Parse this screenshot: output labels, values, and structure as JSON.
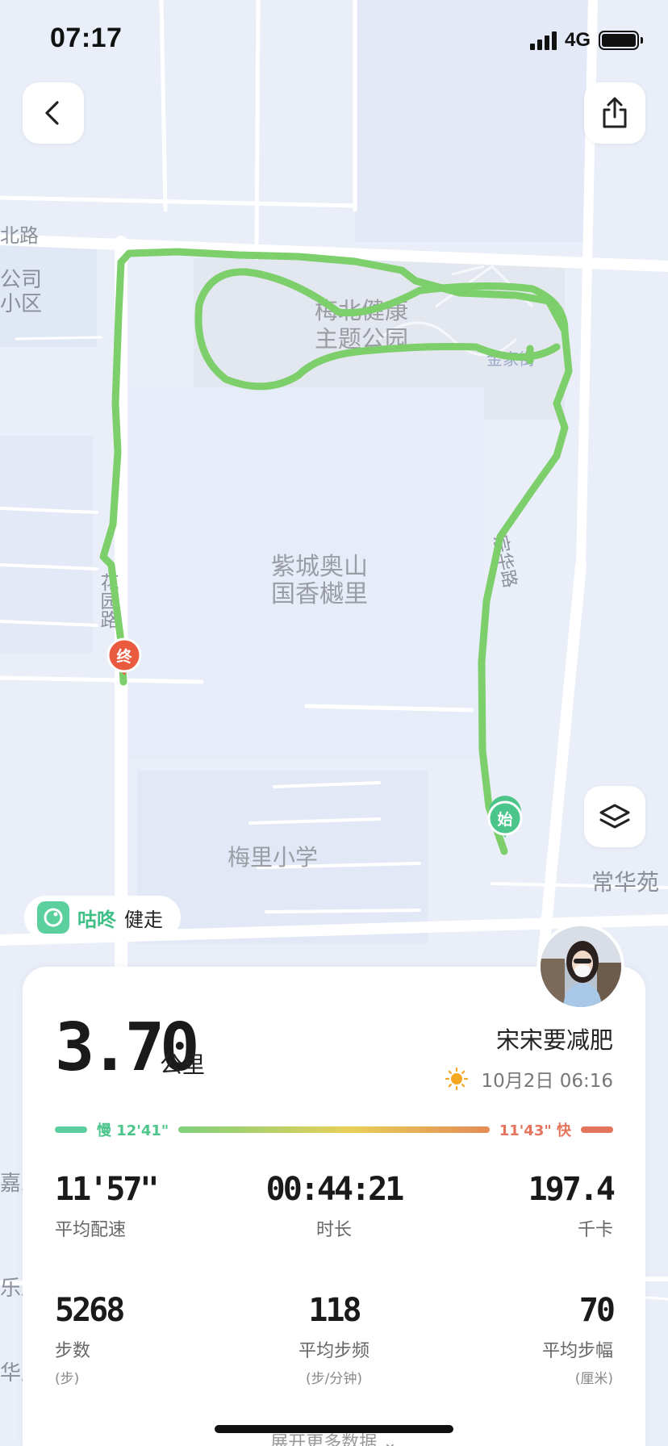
{
  "status_bar": {
    "time": "07:17",
    "network": "4G",
    "signal_icon": "signal-icon",
    "battery_icon": "battery-icon"
  },
  "map": {
    "labels": {
      "road_north": "北路",
      "company": "公司",
      "district": "小区",
      "park_line1": "梅北健康",
      "park_line2": "主题公园",
      "jinjia": "金家街",
      "residence_line1": "紫城奥山",
      "residence_line2": "国香樾里",
      "huayuan_road": "花园路",
      "zonghua_road": "宗华路",
      "school": "梅里小学",
      "changhua": "常华苑",
      "edge1": "嘉乐",
      "edge2": "乐路",
      "edge3": "华庭"
    },
    "start_marker": "始",
    "end_marker": "终",
    "route_color": "#7ccf6a",
    "start_color": "#4cc58a",
    "end_color": "#ea5a3f"
  },
  "buttons": {
    "back_icon": "chevron-left-icon",
    "share_icon": "share-icon",
    "layers_icon": "layers-icon"
  },
  "brand": {
    "name": "咕咚",
    "sub": "健走"
  },
  "summary": {
    "distance": "3.70",
    "distance_unit": "公里",
    "user_name": "宋宋要减肥",
    "date": "10月2日 06:16",
    "weather_icon": "sun-icon"
  },
  "pace_bar": {
    "slow_label": "慢 12'41\"",
    "fast_label": "11'43\" 快",
    "slow_color": "#5ccf9e",
    "fast_color": "#e4745c"
  },
  "stats": [
    {
      "value": "11'57\"",
      "label": "平均配速",
      "sub": ""
    },
    {
      "value": "00:44:21",
      "label": "时长",
      "sub": ""
    },
    {
      "value": "197.4",
      "label": "千卡",
      "sub": ""
    },
    {
      "value": "5268",
      "label": "步数",
      "sub": "(步)"
    },
    {
      "value": "118",
      "label": "平均步频",
      "sub": "(步/分钟)"
    },
    {
      "value": "70",
      "label": "平均步幅",
      "sub": "(厘米)"
    }
  ],
  "expand_label": "展开更多数据"
}
